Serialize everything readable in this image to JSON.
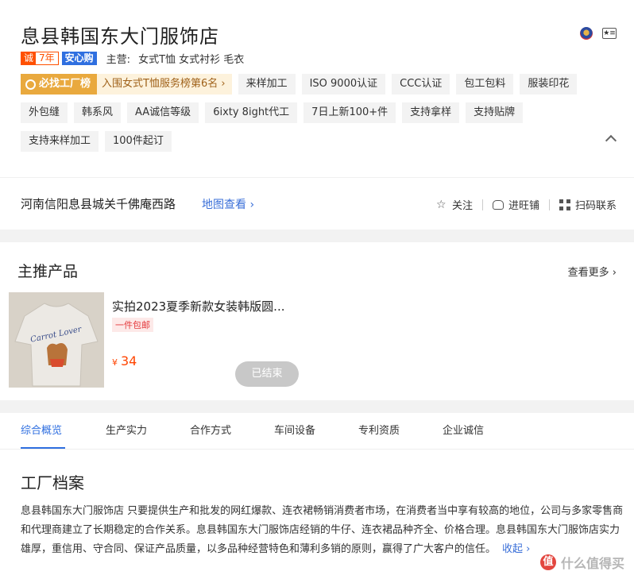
{
  "shop": {
    "title": "息县韩国东大门服饰店",
    "cheng_label": "诚",
    "years": "7年",
    "anxin_label": "安心购",
    "main_label": "主营:",
    "main_value": "女式T恤 女式衬衫 毛衣"
  },
  "factory_tag": {
    "left": "必找工厂榜",
    "right": "入围女式T恤服务榜第6名 ›"
  },
  "tags_row1": [
    "来样加工",
    "ISO 9000认证",
    "CCC认证",
    "包工包料",
    "服装印花"
  ],
  "tags_row2": [
    "外包缝",
    "韩系风",
    "AA诚信等级",
    "6ixty 8ight代工",
    "7日上新100+件",
    "支持拿样",
    "支持贴牌"
  ],
  "tags_row3": [
    "支持来样加工",
    "100件起订"
  ],
  "address": {
    "text": "河南信阳息县城关千佛庵西路",
    "map_link": "地图查看 ›",
    "follow": "关注",
    "wangwang": "进旺铺",
    "scan": "扫码联系"
  },
  "products": {
    "title": "主推产品",
    "see_more": "查看更多 ›",
    "item": {
      "name": "实拍2023夏季新款女装韩版圆...",
      "free_ship": "一件包邮",
      "currency": "¥",
      "price": "34",
      "status": "已结束",
      "image_text": "Carrot Lover"
    }
  },
  "tabs": [
    "综合概览",
    "生产实力",
    "合作方式",
    "车间设备",
    "专利资质",
    "企业诚信"
  ],
  "archive": {
    "title": "工厂档案",
    "desc": "息县韩国东大门服饰店 只要提供生产和批发的网红爆款、连衣裙畅销消费者市场，在消费者当中享有较高的地位，公司与多家零售商和代理商建立了长期稳定的合作关系。息县韩国东大门服饰店经销的牛仔、连衣裙品种齐全、价格合理。息县韩国东大门服饰店实力雄厚，重信用、守合同、保证产品质量，以多品种经营特色和薄利多销的原则，赢得了广大客户的信任。",
    "collapse": "收起 ›"
  },
  "watermark": {
    "logo": "值",
    "text": "什么值得买"
  },
  "colors": {
    "accent_blue": "#2f6fe0",
    "price_orange": "#ff4400",
    "factory_gold": "#e9a93e"
  }
}
